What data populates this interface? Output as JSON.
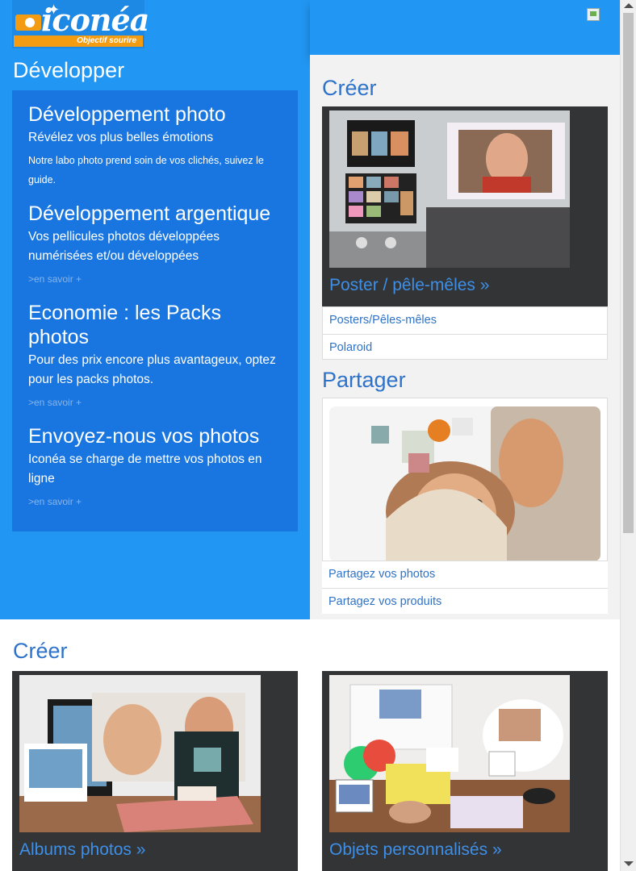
{
  "logo": {
    "brand": "iconéa",
    "tagline": "Objectif sourire"
  },
  "develop": {
    "title": "Développer",
    "items": [
      {
        "title": "Développement photo",
        "lead": "Révélez vos plus belles émotions",
        "desc": "Notre labo photo prend soin de vos clichés, suivez le guide.",
        "more": ""
      },
      {
        "title": "Développement argentique",
        "lead": "Vos pellicules photos développées numérisées et/ou développées",
        "desc": "",
        "more": ">en savoir +"
      },
      {
        "title": "Economie : les Packs photos",
        "lead": "Pour des prix encore plus avantageux, optez pour les packs photos.",
        "desc": "",
        "more": ">en savoir +"
      },
      {
        "title": "Envoyez-nous vos photos",
        "lead": "Iconéa se charge de mettre vos photos en ligne",
        "desc": "",
        "more": ">en savoir +"
      }
    ]
  },
  "create_right": {
    "title": "Créer",
    "card_caption": "Poster / pêle-mêles »",
    "links": [
      "Posters/Pêles-mêles",
      "Polaroid"
    ]
  },
  "share": {
    "title": "Partager",
    "links": [
      "Partagez vos photos",
      "Partagez vos produits"
    ]
  },
  "create_bottom": {
    "title": "Créer",
    "cards": [
      {
        "caption": "Albums photos »"
      },
      {
        "caption": "Objets personnalisés »"
      }
    ]
  },
  "colors": {
    "accent_blue": "#2196f3",
    "panel_blue": "#1976e0",
    "link_blue": "#2e73c9"
  }
}
